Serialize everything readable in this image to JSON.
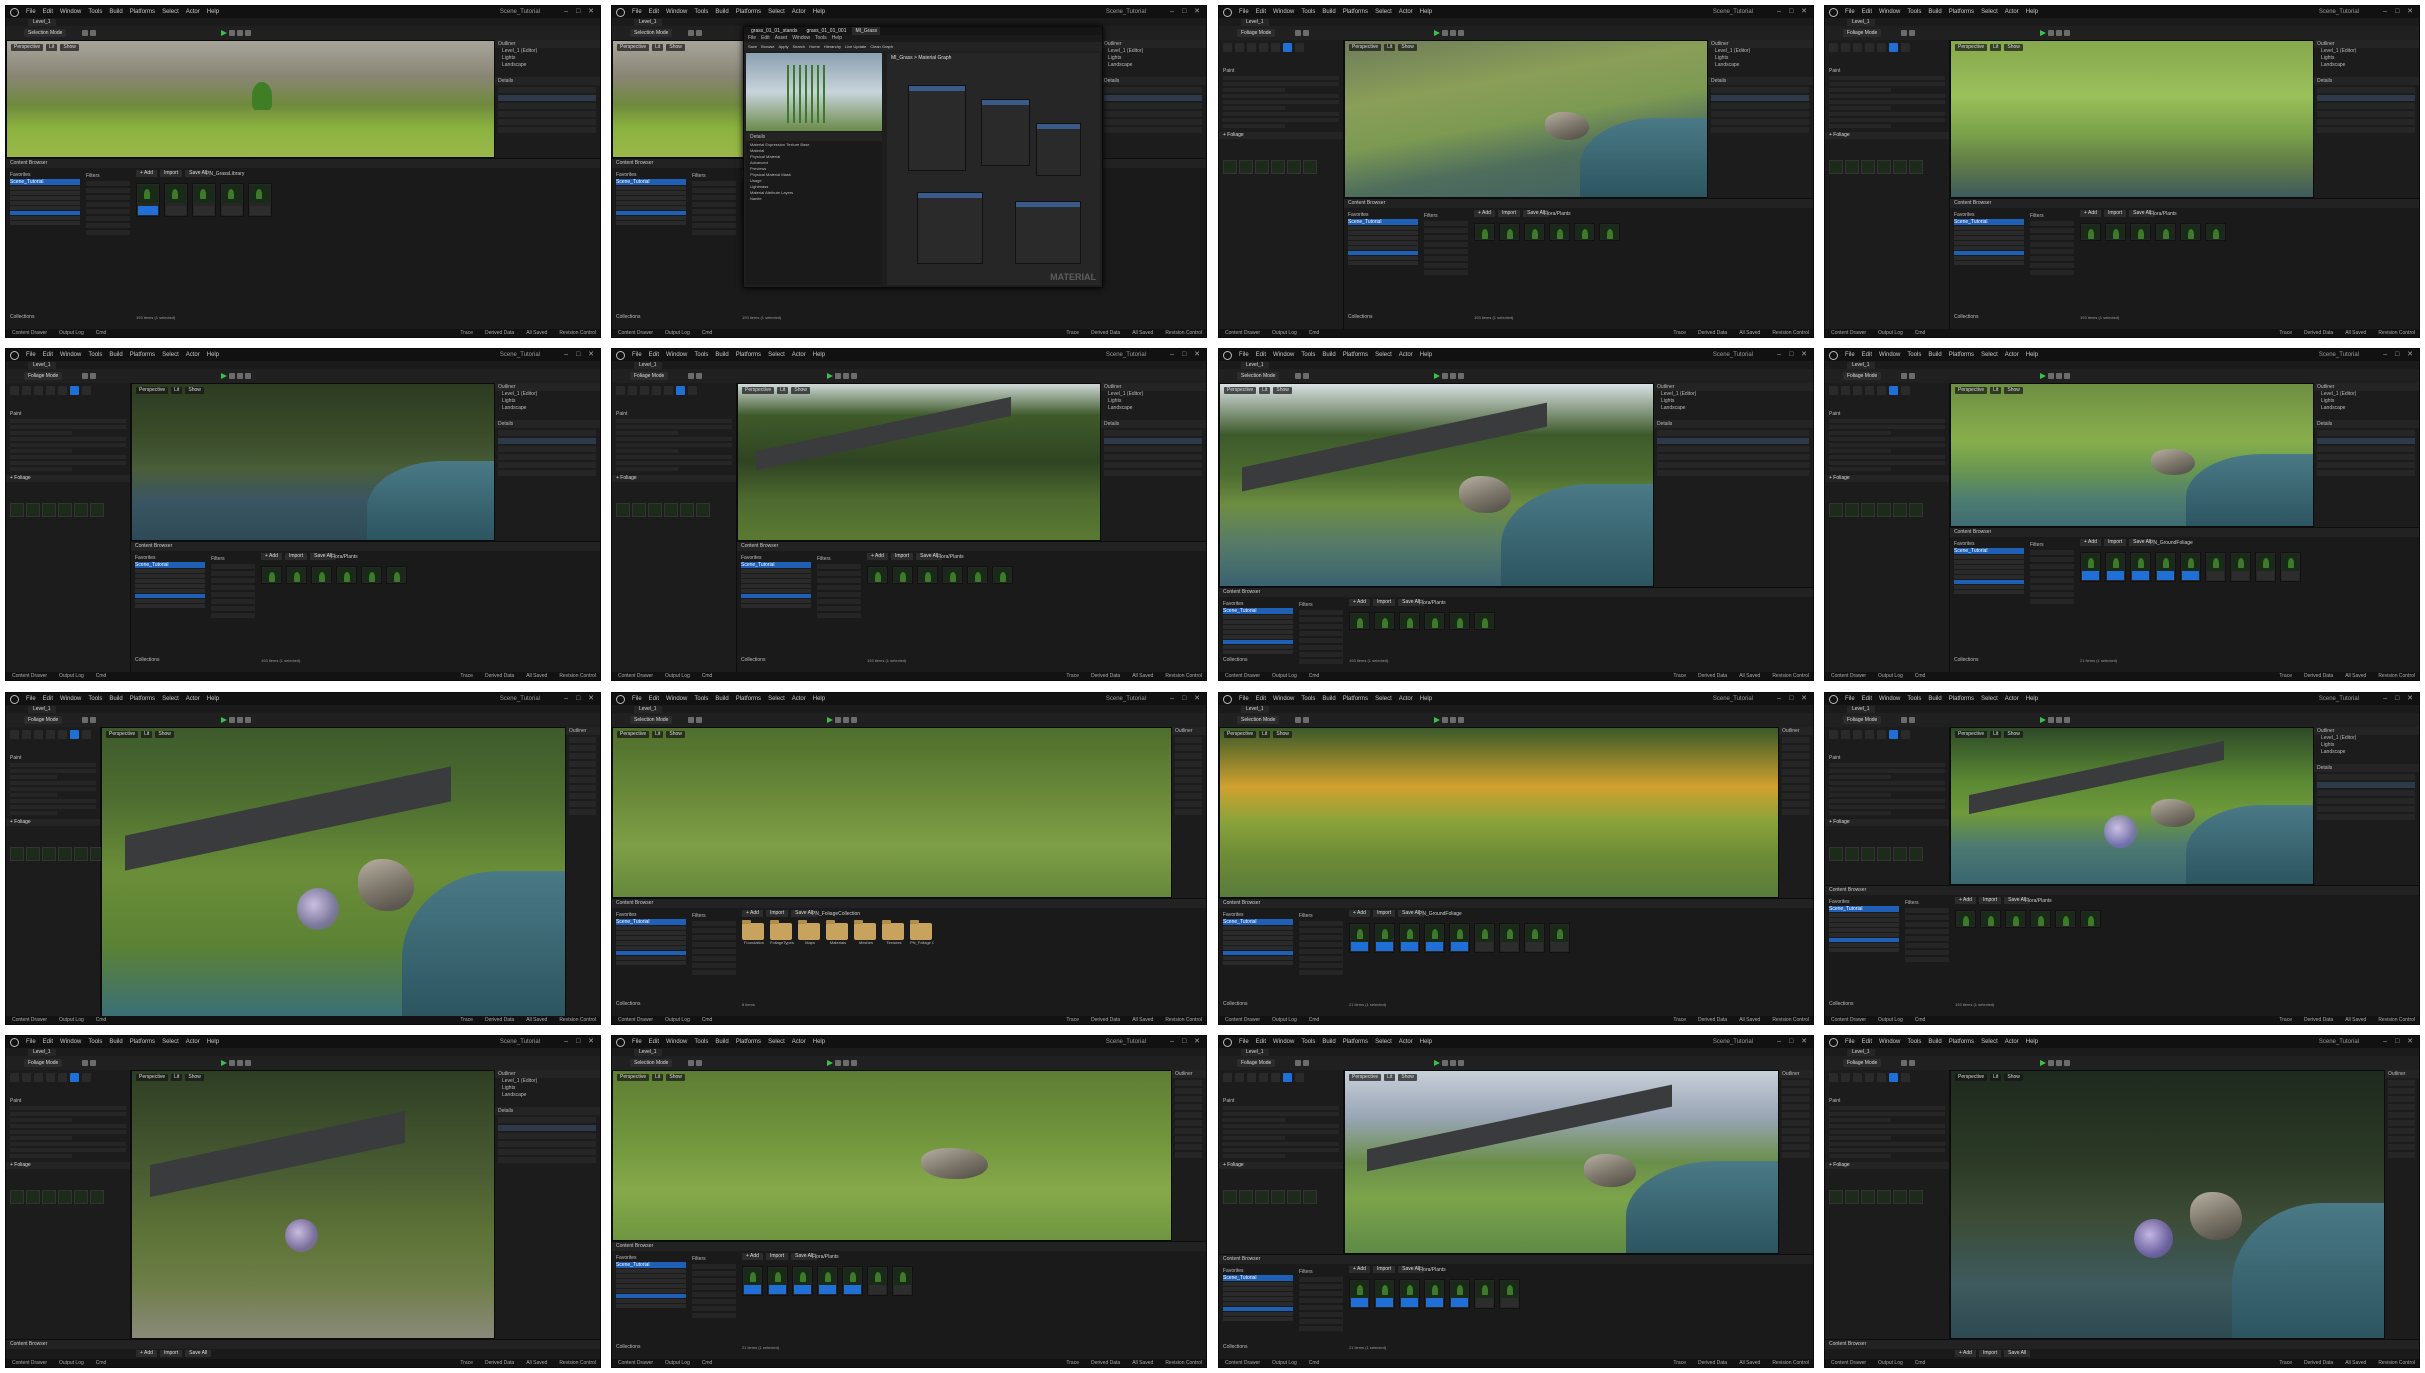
{
  "app": {
    "menu": [
      "File",
      "Edit",
      "Window",
      "Tools",
      "Build",
      "Platforms",
      "Select",
      "Actor",
      "Help"
    ],
    "project_title": "Scene_Tutorial",
    "level_tab": "Level_1",
    "window_controls": "– □ ✕"
  },
  "toolbar": {
    "mode_selection": "Selection Mode",
    "mode_foliage": "Foliage Mode",
    "perspective": "Perspective",
    "lit": "Lit",
    "show": "Show"
  },
  "outliner": {
    "title": "Outliner",
    "item_label": "Item Label",
    "type": "Type",
    "items": [
      "Level_1 (Editor)",
      "Lights",
      "Landscape"
    ],
    "actors_count": "21 actors"
  },
  "details": {
    "title": "Details",
    "landscape": "Landscape",
    "paint": "Paint",
    "brush_size": "Brush Size",
    "paint_density": "Paint Density",
    "erase_density": "Erase Density",
    "single_instance_mode": "Single Instance Mode",
    "filters": "Filters",
    "landscape_opt": "Landscape",
    "static_mesh_opt": "Static Mesh",
    "bsp": "BSP",
    "foliage_opt": "Foliage",
    "translucent": "Translucent",
    "foliage_label": "+ Foliage",
    "search_foliage": "Search Foliage"
  },
  "content_browser": {
    "title": "Content Browser",
    "add": "+ Add",
    "import": "Import",
    "save_all": "Save All",
    "path_root": "All",
    "path_content": "Content",
    "path_grass": "PN_GrassLibrary",
    "path_foliage": "PN_FoliageCollection",
    "path_ground": "PN_GroundFoliage",
    "path_stack": "StackO",
    "path_plants": "Plants",
    "path_flora": "Flora/Plants",
    "favorites": "Favorites",
    "scene_tutorial": "Scene_Tutorial",
    "collections": "Collections",
    "filters": "Filters",
    "search_placeholder": "Search PN_GrassLibrary",
    "items_count": "193 items (1 selected)",
    "items_count_2": "21 items (1 selected)",
    "items_count_3": "8 items"
  },
  "folders": [
    "Foundation",
    "FoliageTypes",
    "Maps",
    "Materials",
    "Meshes",
    "Textures",
    "PN_Foliage Collection"
  ],
  "assets_grass": [
    "grass_01_01",
    "grass_01_02",
    "grass_01_03",
    "grass_01_04",
    "grass_01_05"
  ],
  "assets_ground": [
    "grass_01_07",
    "grass_01_06",
    "grass_01_09",
    "grass_01_02",
    "grass_01_02",
    "grass_01_08",
    "grass_01_01",
    "grass_01_08",
    "grass_01_03"
  ],
  "material_editor": {
    "title": "MI_Grass",
    "subtitle": "MI_Grass > Material Graph",
    "tabs": [
      "grass_01_01_stands",
      "grass_01_01_001",
      "MI_Grass"
    ],
    "menu": [
      "File",
      "Edit",
      "Asset",
      "Window",
      "Tools",
      "Help"
    ],
    "toolbar": [
      "Save",
      "Browse",
      "Apply",
      "Search",
      "Home",
      "Hierarchy",
      "Live Update",
      "Clean Graph"
    ],
    "details_tab": "Details",
    "params_tab": "Parameter Defaults",
    "preview_label": "MATERIAL",
    "sections": [
      "Material Expression Texture Base",
      "Material",
      "Physical Material",
      "Advanced",
      "Previews",
      "Physical Material Mask",
      "Usage",
      "Lightmass",
      "Material Attribute Layers",
      "Nanite"
    ]
  },
  "bottom_bar": {
    "content_drawer": "Content Drawer",
    "output_log": "Output Log",
    "cmd": "Cmd",
    "trace": "Trace",
    "derived_data": "Derived Data",
    "all_saved": "All Saved",
    "revision_control": "Revision Control"
  },
  "foliage_counts": [
    "303",
    "209",
    "211",
    "197",
    "206"
  ],
  "colors": {
    "accent": "#1f6fd6",
    "play": "#39c24b",
    "panel": "#1c1c1c",
    "dark": "#151515"
  }
}
